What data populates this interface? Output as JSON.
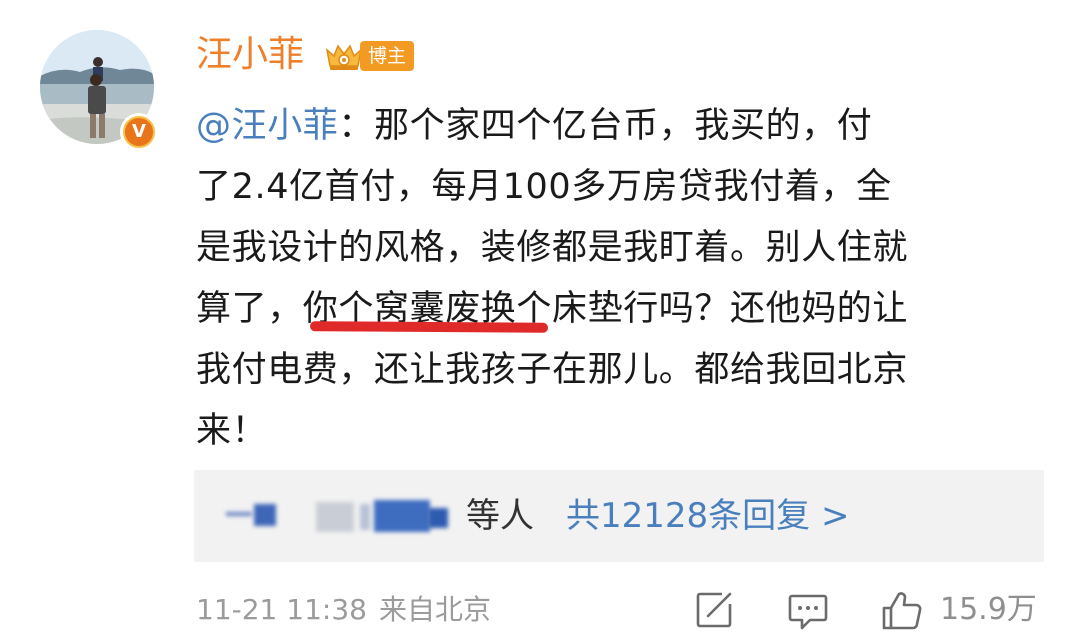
{
  "user": {
    "name": "汪小菲",
    "badge_label": "博主",
    "verified_mark": "V"
  },
  "comment": {
    "mention": "@汪小菲",
    "lines": [
      "：那个家四个亿台币，我买的，付",
      "了2.4亿首付，每月100多万房贷我付着，全",
      "是我设计的风格，装修都是我盯着。别人住就",
      "算了，你个窝囊废换个床垫行吗？还他妈的让",
      "我付电费，还让我孩子在那儿。都给我回北京",
      "来！"
    ]
  },
  "replies": {
    "suffix": "等人",
    "link": "共12128条回复 >"
  },
  "footer": {
    "date": "11-21 11:38",
    "location": "来自北京",
    "like_count": "15.9万"
  },
  "icons": {
    "share": "share-icon",
    "comment": "comment-icon",
    "like": "thumbs-up-icon",
    "crown": "crown-icon"
  },
  "colors": {
    "username": "#ee7f2b",
    "mention": "#4a7fbd",
    "badge": "#f39a22",
    "underline": "#e02a2a",
    "meta": "#9b9b9b",
    "reply_bar": "#f2f2f2"
  }
}
